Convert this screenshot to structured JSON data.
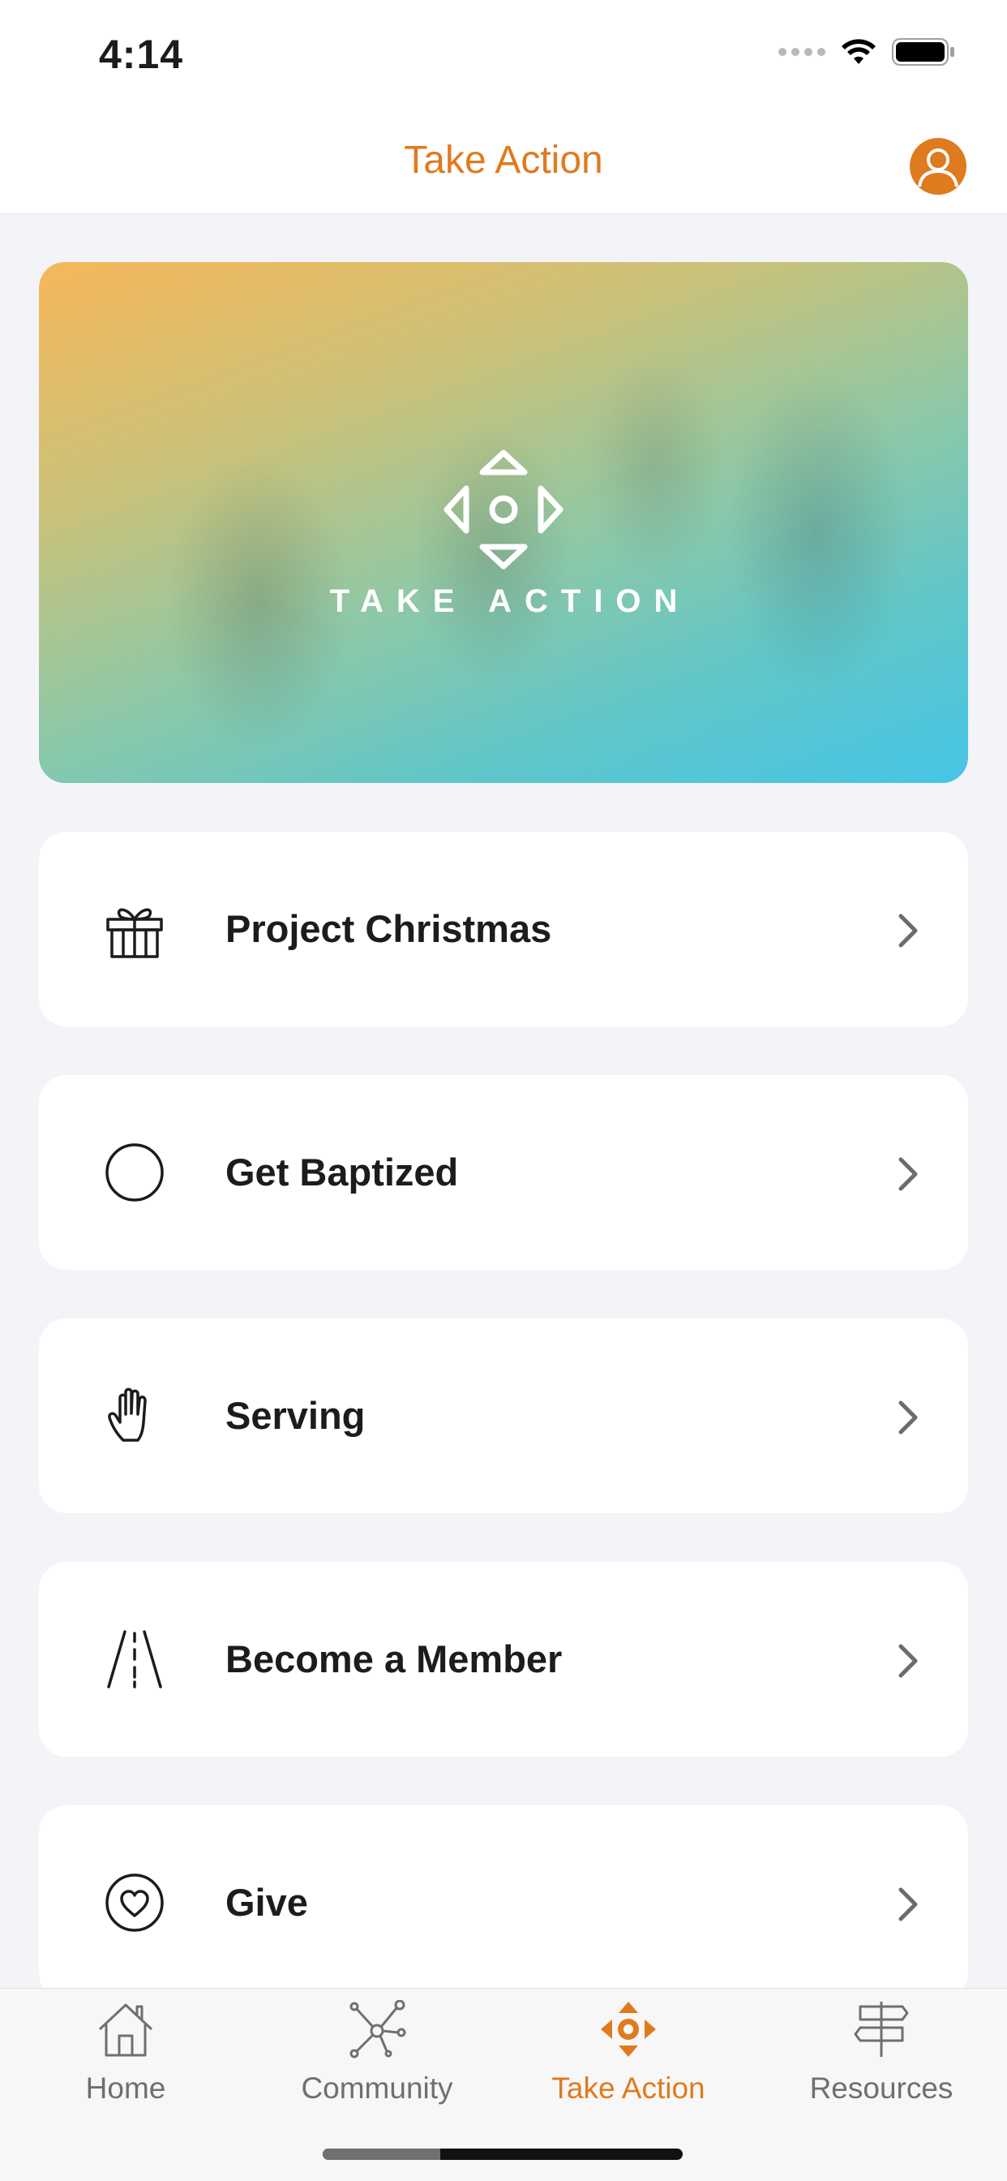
{
  "status_bar": {
    "time": "4:14"
  },
  "nav": {
    "title": "Take Action"
  },
  "hero": {
    "caption": "TAKE ACTION"
  },
  "items": [
    {
      "label": "Project Christmas",
      "icon": "gift-icon"
    },
    {
      "label": "Get Baptized",
      "icon": "circle-icon"
    },
    {
      "label": "Serving",
      "icon": "hand-icon"
    },
    {
      "label": "Become a Member",
      "icon": "road-icon"
    },
    {
      "label": "Give",
      "icon": "heart-circle-icon"
    }
  ],
  "tabs": [
    {
      "label": "Home",
      "icon": "house-icon",
      "active": false
    },
    {
      "label": "Community",
      "icon": "network-icon",
      "active": false
    },
    {
      "label": "Take Action",
      "icon": "take-action-icon",
      "active": true
    },
    {
      "label": "Resources",
      "icon": "signpost-icon",
      "active": false
    }
  ],
  "colors": {
    "accent": "#e07a1f",
    "background": "#f3f4f8",
    "card": "#ffffff",
    "text": "#1c1c1e"
  }
}
